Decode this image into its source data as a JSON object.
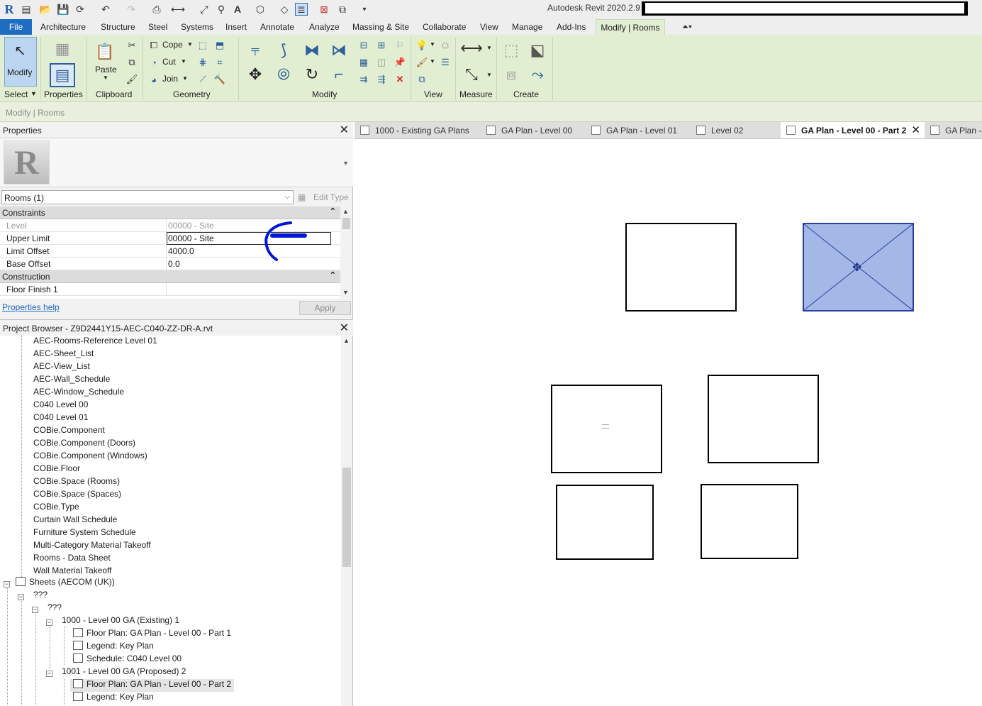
{
  "app": {
    "title": "Autodesk Revit 2020.2.9",
    "logo_letter": "R"
  },
  "ribbon_tabs": [
    "File",
    "Architecture",
    "Structure",
    "Steel",
    "Systems",
    "Insert",
    "Annotate",
    "Analyze",
    "Massing & Site",
    "Collaborate",
    "View",
    "Manage",
    "Add-Ins",
    "Modify | Rooms"
  ],
  "ribbon": {
    "modify_label": "Modify",
    "select_label": "Select",
    "properties_label": "Properties",
    "paste_label": "Paste",
    "clipboard_label": "Clipboard",
    "cope_label": "Cope",
    "cut_label": "Cut",
    "join_label": "Join",
    "geometry_label": "Geometry",
    "modify_panel_label": "Modify",
    "view_label": "View",
    "measure_label": "Measure",
    "create_label": "Create"
  },
  "options_bar": {
    "label": "Modify | Rooms"
  },
  "properties": {
    "title": "Properties",
    "instance_selector": "Rooms (1)",
    "edit_type": "Edit Type",
    "groups": {
      "constraints": "Constraints",
      "construction": "Construction"
    },
    "rows": {
      "level": {
        "name": "Level",
        "value": "00000 - Site"
      },
      "upper_limit": {
        "name": "Upper Limit",
        "value": "00000 - Site"
      },
      "limit_offset": {
        "name": "Limit Offset",
        "value": "4000.0"
      },
      "base_offset": {
        "name": "Base Offset",
        "value": "0.0"
      },
      "floor_finish": {
        "name": "Floor Finish 1",
        "value": ""
      }
    },
    "help_link": "Properties help",
    "apply": "Apply"
  },
  "browser": {
    "title": "Project Browser - Z9D2441Y15-AEC-C040-ZZ-DR-A.rvt",
    "schedules": [
      "AEC-Rooms-Reference Level 01",
      "AEC-Sheet_List",
      "AEC-View_List",
      "AEC-Wall_Schedule",
      "AEC-Window_Schedule",
      "C040 Level 00",
      "C040 Level 01",
      "COBie.Component",
      "COBie.Component (Doors)",
      "COBie.Component (Windows)",
      "COBie.Floor",
      "COBie.Space (Rooms)",
      "COBie.Space (Spaces)",
      "COBie.Type",
      "Curtain Wall Schedule",
      "Furniture System Schedule",
      "Multi-Category Material Takeoff",
      "Rooms - Data Sheet",
      "Wall Material Takeoff"
    ],
    "sheets_root": "Sheets (AECOM (UK))",
    "group_1": "???",
    "group_2": "???",
    "sheet_1": {
      "name": "1000 - Level 00 GA (Existing) 1",
      "children": [
        "Floor Plan: GA Plan - Level 00 - Part 1",
        "Legend: Key Plan",
        "Schedule: C040 Level 00"
      ]
    },
    "sheet_2": {
      "name": "1001 - Level 00 GA (Proposed) 2",
      "children": [
        "Floor Plan: GA Plan - Level 00 - Part 2",
        "Legend: Key Plan"
      ]
    }
  },
  "view_tabs": [
    "1000 - Existing GA Plans",
    "GA Plan - Level 00",
    "GA Plan - Level 01",
    "Level 02",
    "GA Plan - Level 00 - Part 2",
    "GA Plan -"
  ],
  "colors": {
    "accent": "#1e6cc4",
    "ribbon_bg": "#e1eed2",
    "room_selected_fill": "#a3b8e6",
    "annotation_arrow": "#0018d6"
  }
}
